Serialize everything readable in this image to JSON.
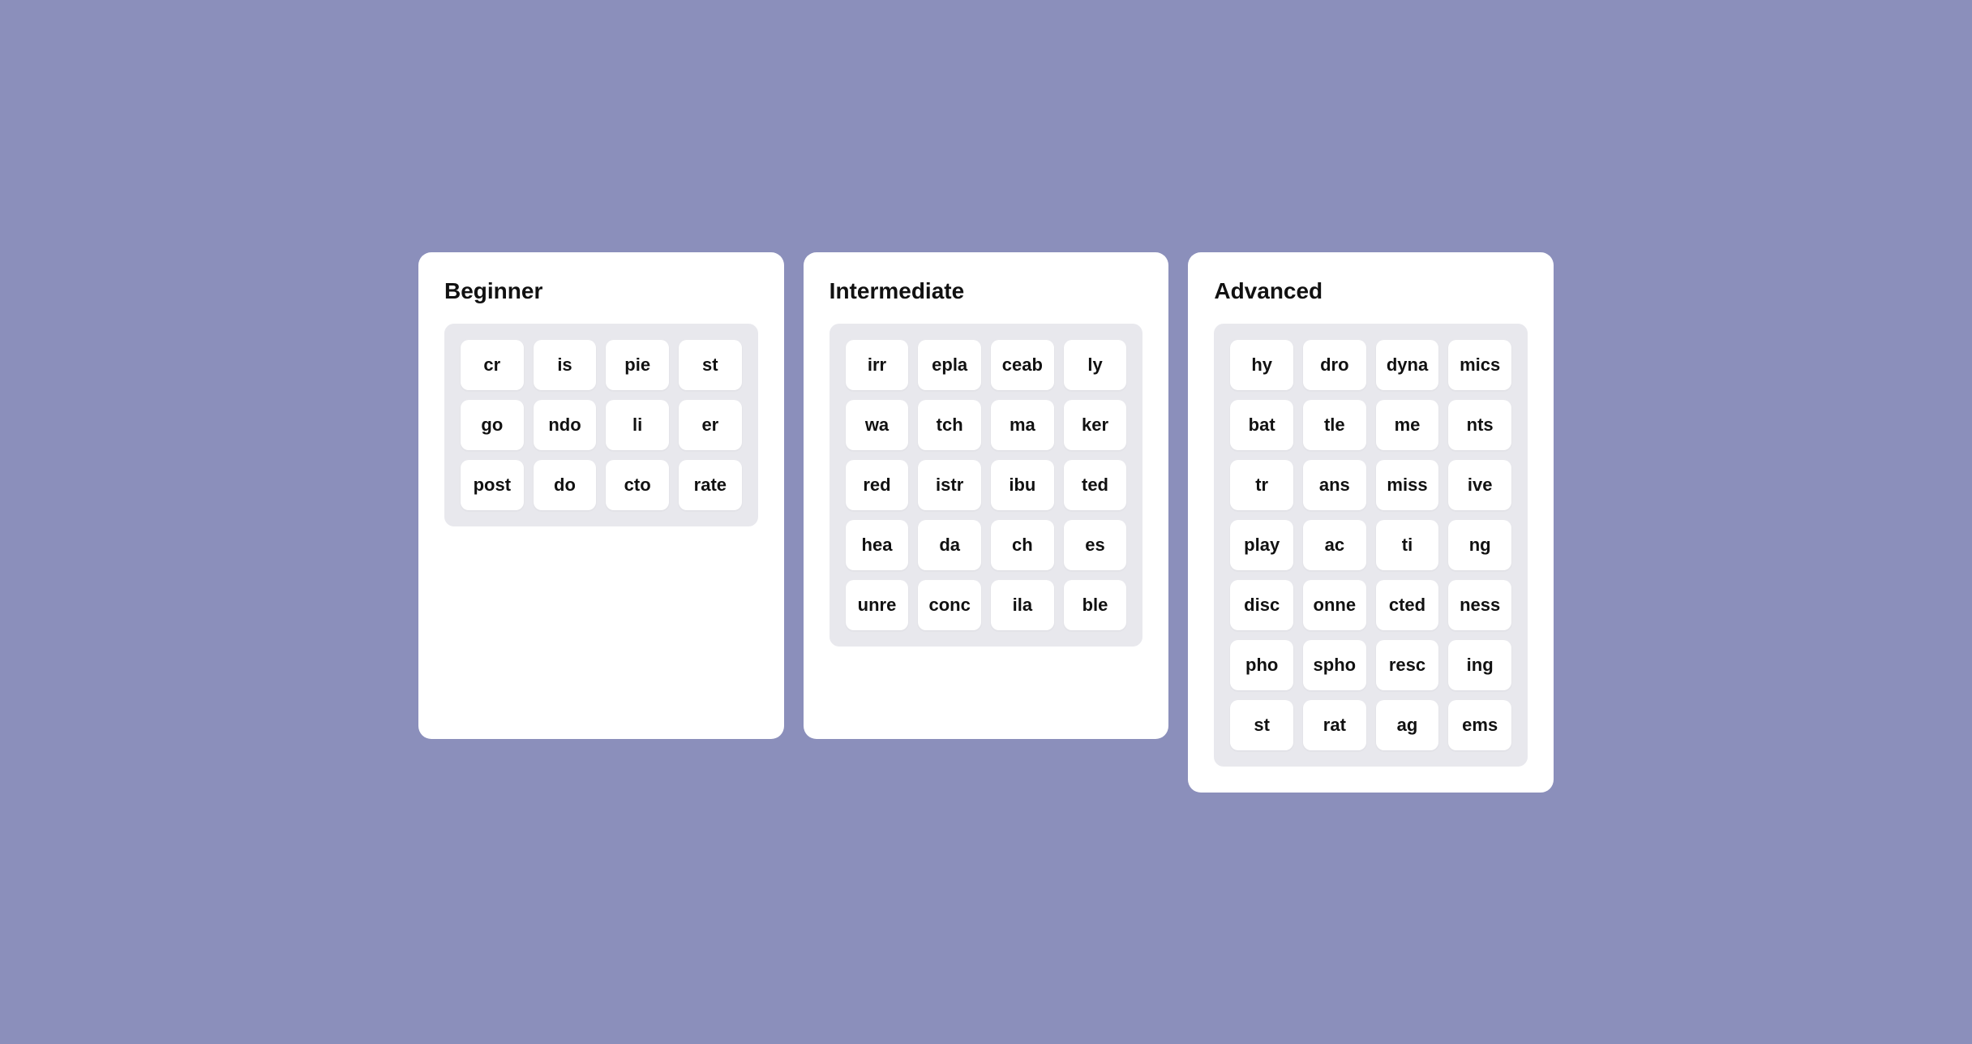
{
  "background_color": "#8b8fbb",
  "sections": [
    {
      "id": "beginner",
      "title": "Beginner",
      "cols": 4,
      "tiles": [
        "cr",
        "is",
        "pie",
        "st",
        "go",
        "ndo",
        "li",
        "er",
        "post",
        "do",
        "cto",
        "rate"
      ]
    },
    {
      "id": "intermediate",
      "title": "Intermediate",
      "cols": 4,
      "tiles": [
        "irr",
        "epla",
        "ceab",
        "ly",
        "wa",
        "tch",
        "ma",
        "ker",
        "red",
        "istr",
        "ibu",
        "ted",
        "hea",
        "da",
        "ch",
        "es",
        "unre",
        "conc",
        "ila",
        "ble"
      ]
    },
    {
      "id": "advanced",
      "title": "Advanced",
      "cols": 4,
      "tiles": [
        "hy",
        "dro",
        "dyna",
        "mics",
        "bat",
        "tle",
        "me",
        "nts",
        "tr",
        "ans",
        "miss",
        "ive",
        "play",
        "ac",
        "ti",
        "ng",
        "disc",
        "onne",
        "cted",
        "ness",
        "pho",
        "spho",
        "resc",
        "ing",
        "st",
        "rat",
        "ag",
        "ems"
      ]
    }
  ]
}
